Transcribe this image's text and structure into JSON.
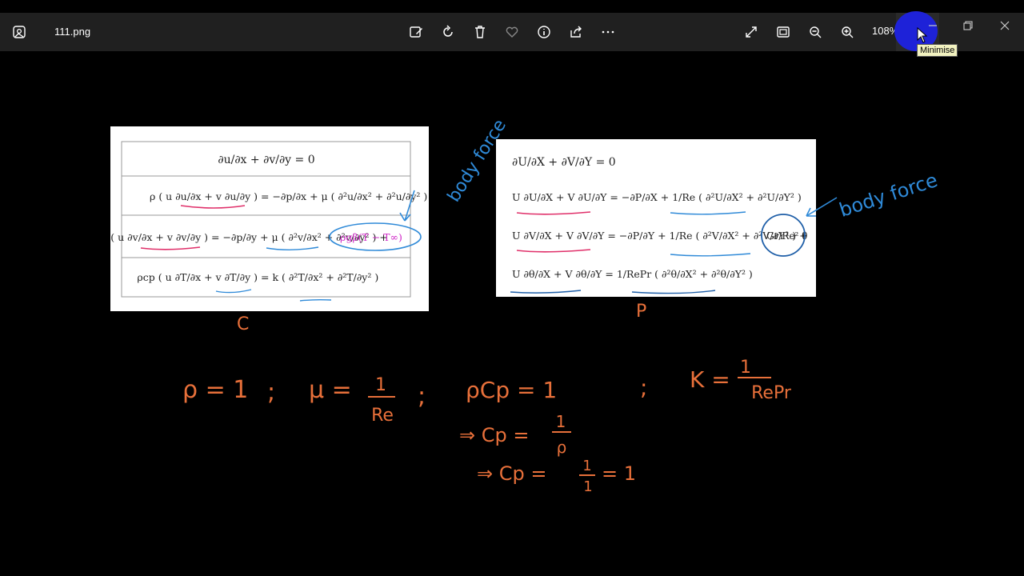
{
  "toolbar": {
    "filename": "111.png",
    "zoom": "108%",
    "tooltip": "Minimise",
    "icons": [
      "photos-app-icon",
      "edit-image-icon",
      "rotate-icon",
      "delete-icon",
      "favorite-icon",
      "info-icon",
      "share-icon",
      "more-icon",
      "fullscreen-icon",
      "fit-window-icon",
      "zoom-out-icon",
      "zoom-in-icon",
      "minimize-icon",
      "restore-icon",
      "close-icon"
    ]
  },
  "left_panel": {
    "eq1": "∂u/∂x + ∂v/∂y = 0",
    "eq2_lhs": "ρ ( u ∂u/∂x + v ∂u/∂y )",
    "eq2_rhs": "= −∂p/∂x + μ ( ∂²u/∂x² + ∂²u/∂y² )",
    "eq3_lhs": "ρ ( u ∂v/∂x + v ∂v/∂y )",
    "eq3_rhs": "= −∂p/∂y + μ ( ∂²v/∂x² + ∂²v/∂y² ) +",
    "eq3_body": "ρgβ(T − T∞)",
    "eq4_lhs": "ρcp ( u ∂T/∂x + v ∂T/∂y )",
    "eq4_rhs": "= k ( ∂²T/∂x² + ∂²T/∂y² )",
    "annotation": "body force"
  },
  "right_panel": {
    "eq1": "∂U/∂X + ∂V/∂Y = 0",
    "eq2": "U ∂U/∂X + V ∂U/∂Y = −∂P/∂X + 1/Re ( ∂²U/∂X² + ∂²U/∂Y² )",
    "eq3": "U ∂V/∂X + V ∂V/∂Y = −∂P/∂Y + 1/Re ( ∂²V/∂X² + ∂²V/∂Y² ) +",
    "eq3_body": "Gr/Re² θ",
    "eq4": "U ∂θ/∂X + V ∂θ/∂Y = 1/RePr ( ∂²θ/∂X² + ∂²θ/∂Y² )",
    "annotation": "body force"
  },
  "notes": {
    "label_c": "C",
    "label_p": "P",
    "rho": "ρ = 1",
    "sep1": ";",
    "mu_lhs": "μ =",
    "mu_num": "1",
    "mu_den": "Re",
    "sep2": ";",
    "rhocp": "ρCp = 1",
    "sep3": ";",
    "k_lhs": "K =",
    "k_num": "1",
    "k_den": "RePr",
    "cp1_lhs": "⇒ Cp =",
    "cp1_num": "1",
    "cp1_den": "ρ",
    "cp2_lhs": "⇒ Cp =",
    "cp2_num": "1",
    "cp2_den": "1",
    "cp2_tail": "= 1"
  }
}
